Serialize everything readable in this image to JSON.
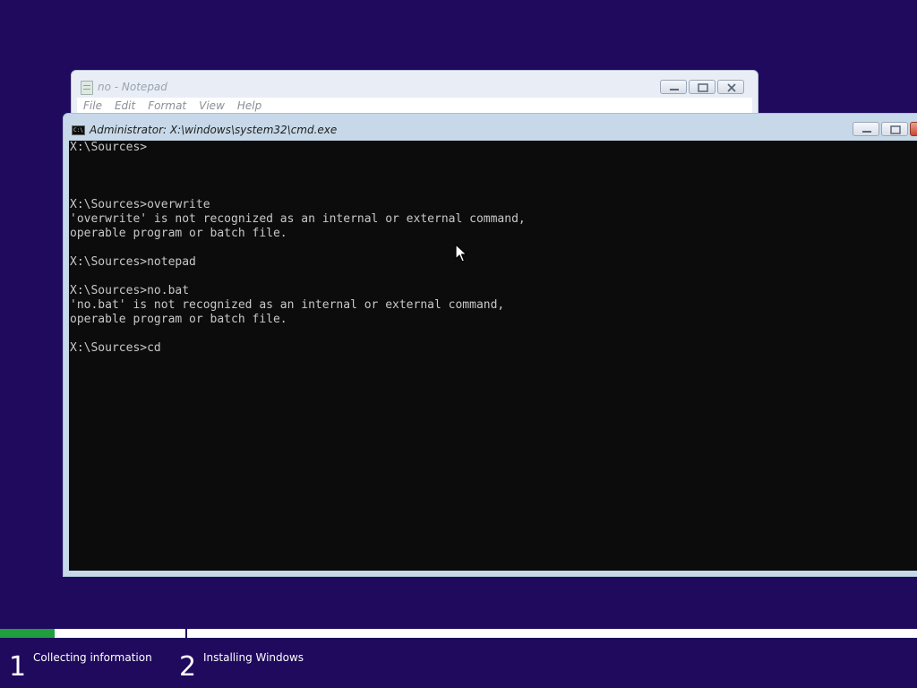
{
  "notepad": {
    "title": "no - Notepad",
    "menu": [
      "File",
      "Edit",
      "Format",
      "View",
      "Help"
    ]
  },
  "cmd": {
    "title": "Administrator: X:\\windows\\system32\\cmd.exe",
    "lines": [
      "X:\\Sources>",
      "",
      "",
      "",
      "X:\\Sources>overwrite",
      "'overwrite' is not recognized as an internal or external command,",
      "operable program or batch file.",
      "",
      "X:\\Sources>notepad",
      "",
      "X:\\Sources>no.bat",
      "'no.bat' is not recognized as an internal or external command,",
      "operable program or batch file.",
      "",
      "X:\\Sources>cd"
    ]
  },
  "setup": {
    "progress_fraction": 0.06,
    "steps": [
      {
        "number": "1",
        "label": "Collecting information"
      },
      {
        "number": "2",
        "label": "Installing Windows"
      }
    ]
  },
  "colors": {
    "desktop": "#1f0a5e",
    "progress": "#1e9e3c",
    "console_bg": "#0c0c0c",
    "console_text": "#c8c8c8"
  },
  "icons": [
    "notepad-icon",
    "cmd-icon",
    "minimize-icon",
    "maximize-icon",
    "close-icon",
    "mouse-pointer-icon"
  ]
}
